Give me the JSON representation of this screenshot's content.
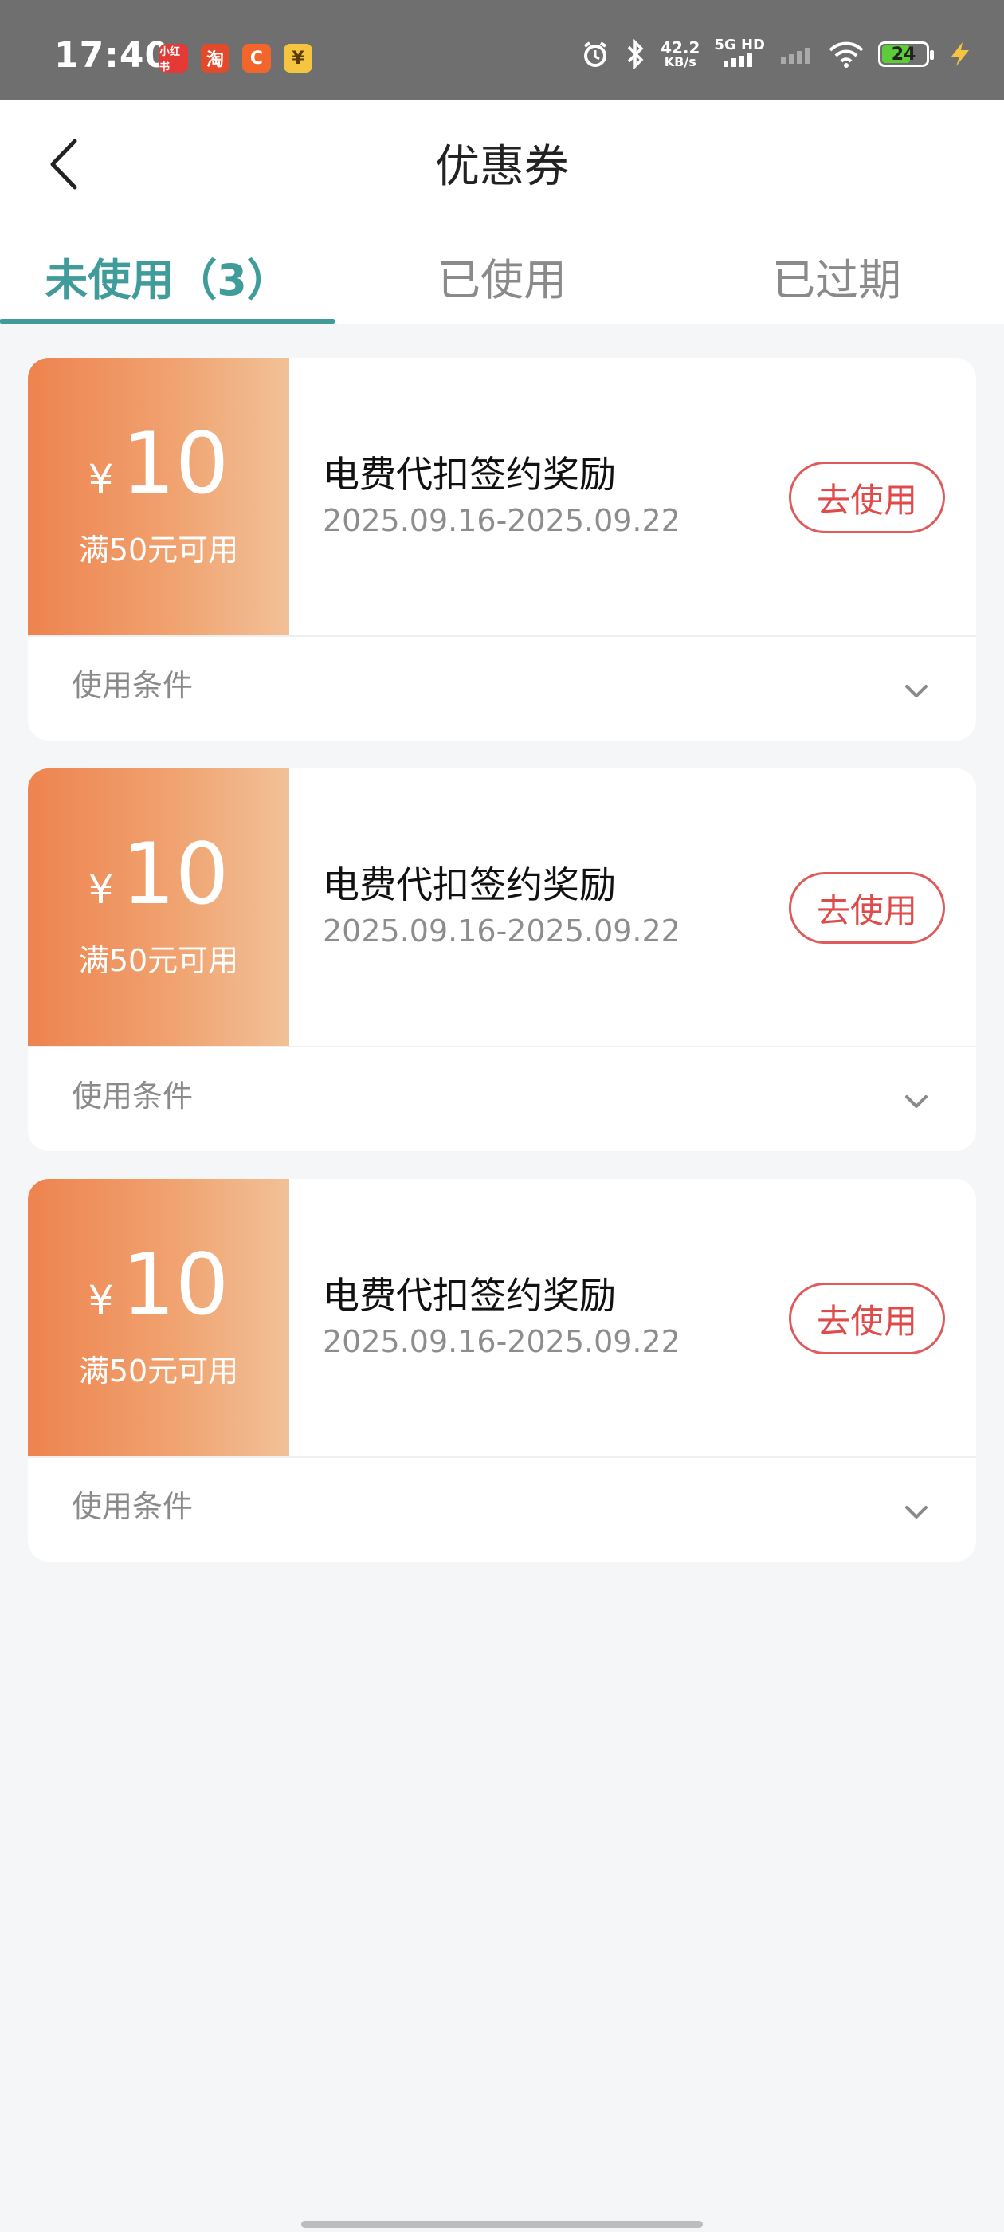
{
  "status_bar": {
    "time": "17:40",
    "app_icons": [
      {
        "name": "xiaohongshu-icon",
        "text": "小红书",
        "style": "red"
      },
      {
        "name": "taobao-icon",
        "text": "淘",
        "style": "taobao"
      },
      {
        "name": "delivery-app-icon",
        "text": "C",
        "style": "orange"
      },
      {
        "name": "yuan-app-icon",
        "text": "¥",
        "style": "yellow"
      }
    ],
    "speed_value": "42.2",
    "speed_unit": "KB/s",
    "network": "5G HD",
    "battery": "24",
    "battery_level": 0.6
  },
  "header": {
    "title": "优惠券",
    "tabs": [
      {
        "label": "未使用（3）",
        "active": true
      },
      {
        "label": "已使用",
        "active": false
      },
      {
        "label": "已过期",
        "active": false
      }
    ]
  },
  "coupons": [
    {
      "currency": "¥",
      "amount": "10",
      "threshold": "满50元可用",
      "title": "电费代扣签约奖励",
      "date_range": "2025.09.16-2025.09.22",
      "button_label": "去使用",
      "conditions_label": "使用条件"
    },
    {
      "currency": "¥",
      "amount": "10",
      "threshold": "满50元可用",
      "title": "电费代扣签约奖励",
      "date_range": "2025.09.16-2025.09.22",
      "button_label": "去使用",
      "conditions_label": "使用条件"
    },
    {
      "currency": "¥",
      "amount": "10",
      "threshold": "满50元可用",
      "title": "电费代扣签约奖励",
      "date_range": "2025.09.16-2025.09.22",
      "button_label": "去使用",
      "conditions_label": "使用条件"
    }
  ],
  "colors": {
    "accent": "#3f9c9a",
    "coupon_gradient_start": "#ee834f",
    "coupon_gradient_end": "#f2c197",
    "use_button": "#de4b4b"
  }
}
